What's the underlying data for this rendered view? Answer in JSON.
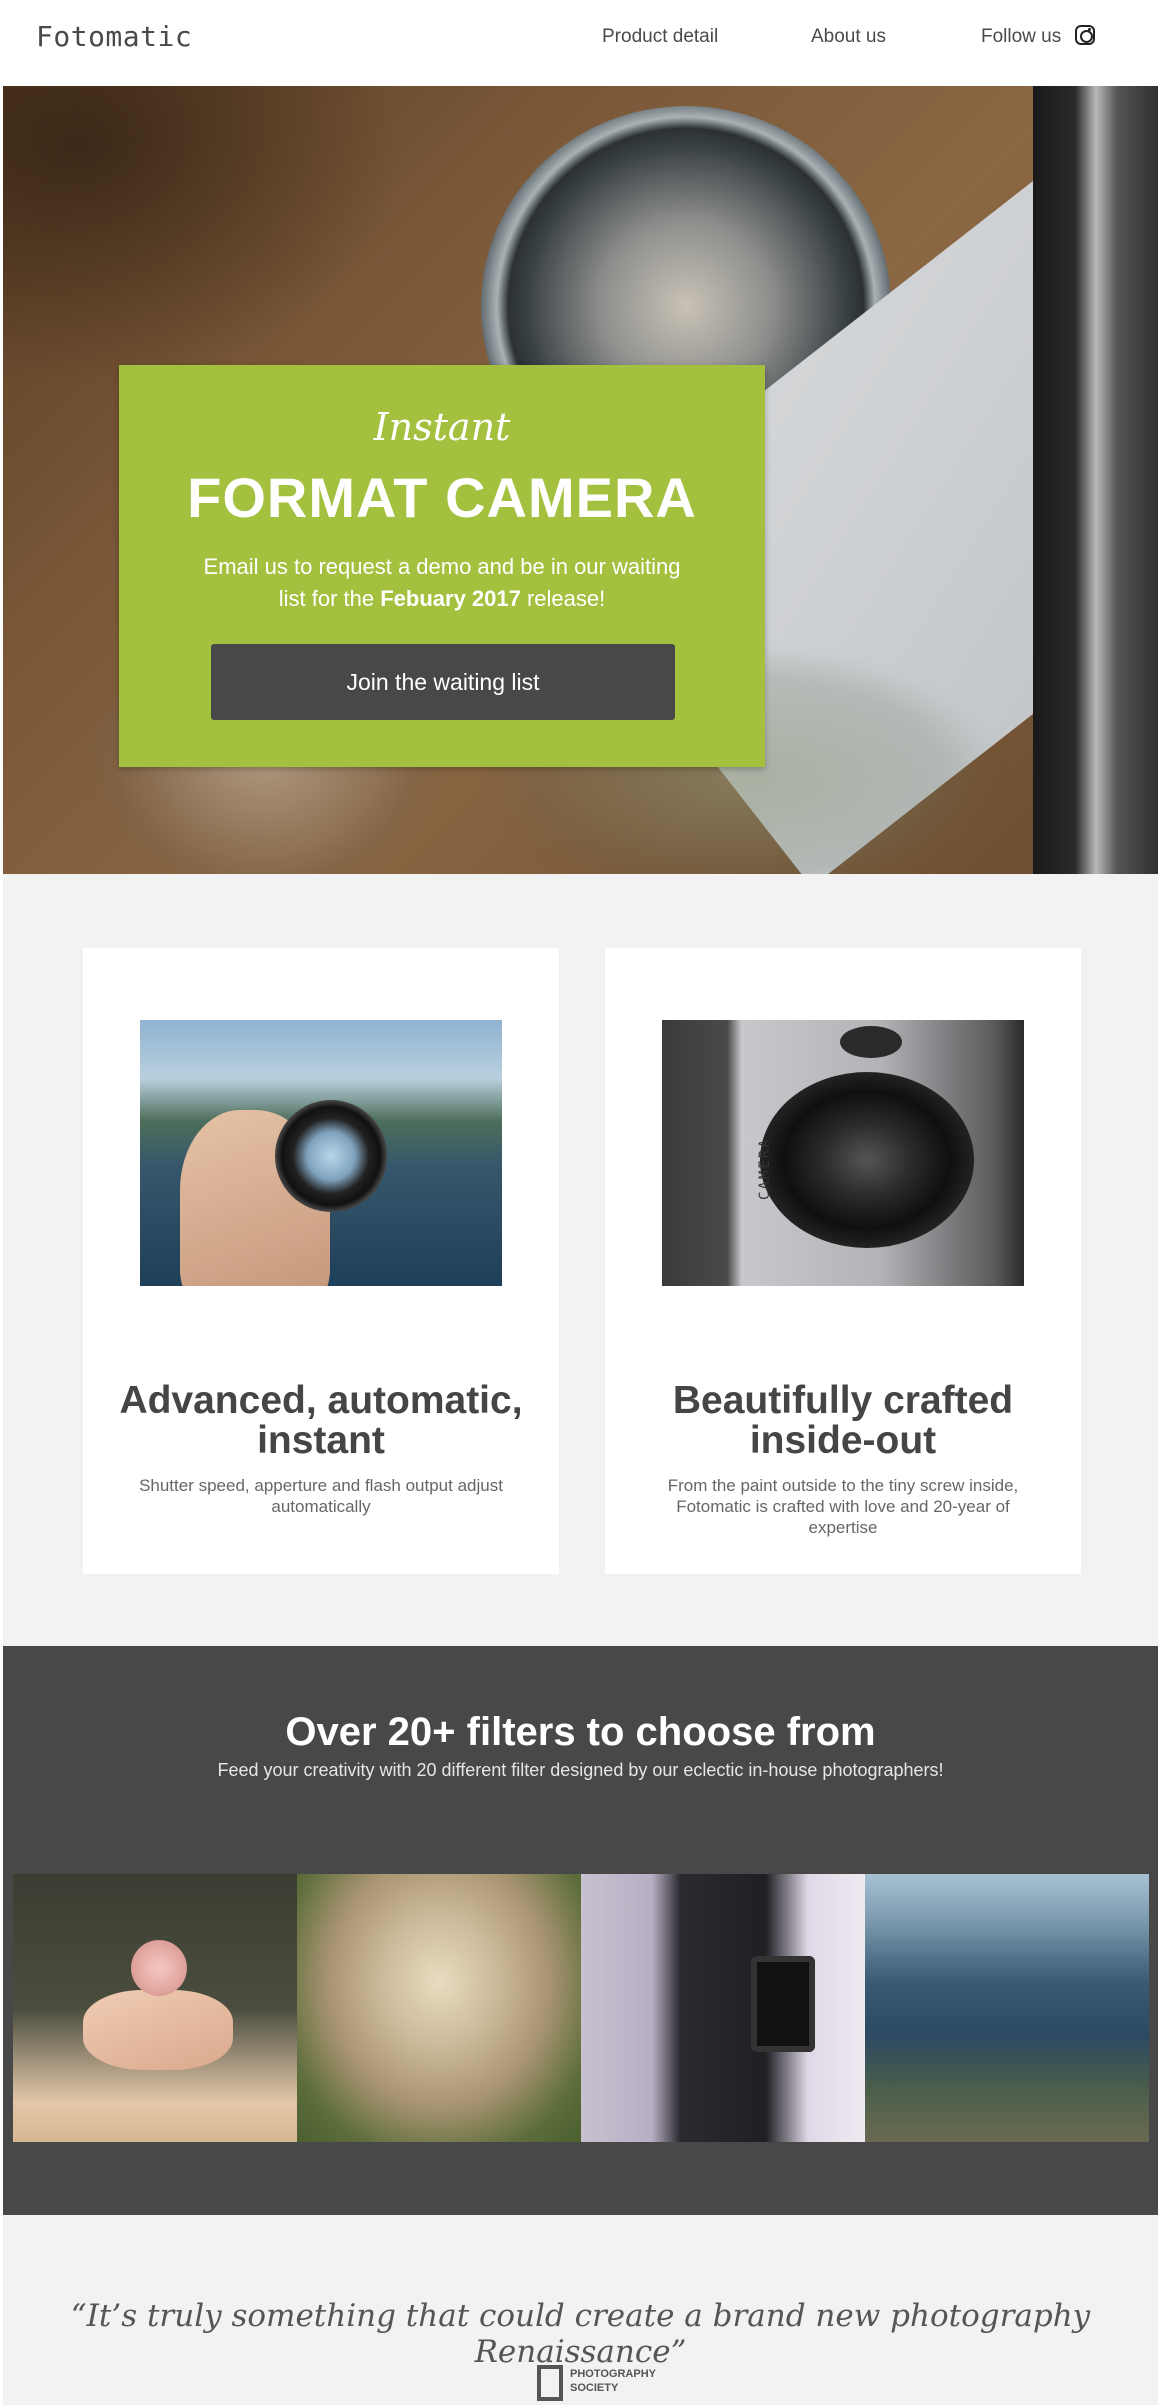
{
  "brand": {
    "logo": "Fotomatic"
  },
  "nav": {
    "product": "Product detail",
    "about": "About us",
    "follow": "Follow us",
    "follow_icon": "instagram-icon"
  },
  "hero": {
    "overline": "Instant",
    "title": "FORMAT CAMERA",
    "text_before": "Email us to request a demo and be in our waiting list for the ",
    "text_bold": "Febuary 2017",
    "text_after": " release!",
    "button": "Join the waiting list",
    "accent": "#a3c13f",
    "button_color": "#484848"
  },
  "features": [
    {
      "title": "Advanced, automatic, instant",
      "description": "Shutter speed, apperture and flash output adjust automatically"
    },
    {
      "title": "Beautifully crafted inside-out",
      "description": "From the paint outside to the tiny screw inside, Fotomatic is crafted with love and 20-year of expertise"
    }
  ],
  "filters": {
    "title": "Over 20+ filters to choose from",
    "subtitle": "Feed your creativity with 20 different filter designed by our eclectic in-house photographers!",
    "background": "#484848"
  },
  "quote": {
    "text": "“It’s truly something that could create a brand new photography Renaissance”",
    "source_line1": "PHOTOGRAPHY",
    "source_line2": "SOCIETY"
  },
  "images": {
    "lens_label": "CAMERA"
  }
}
